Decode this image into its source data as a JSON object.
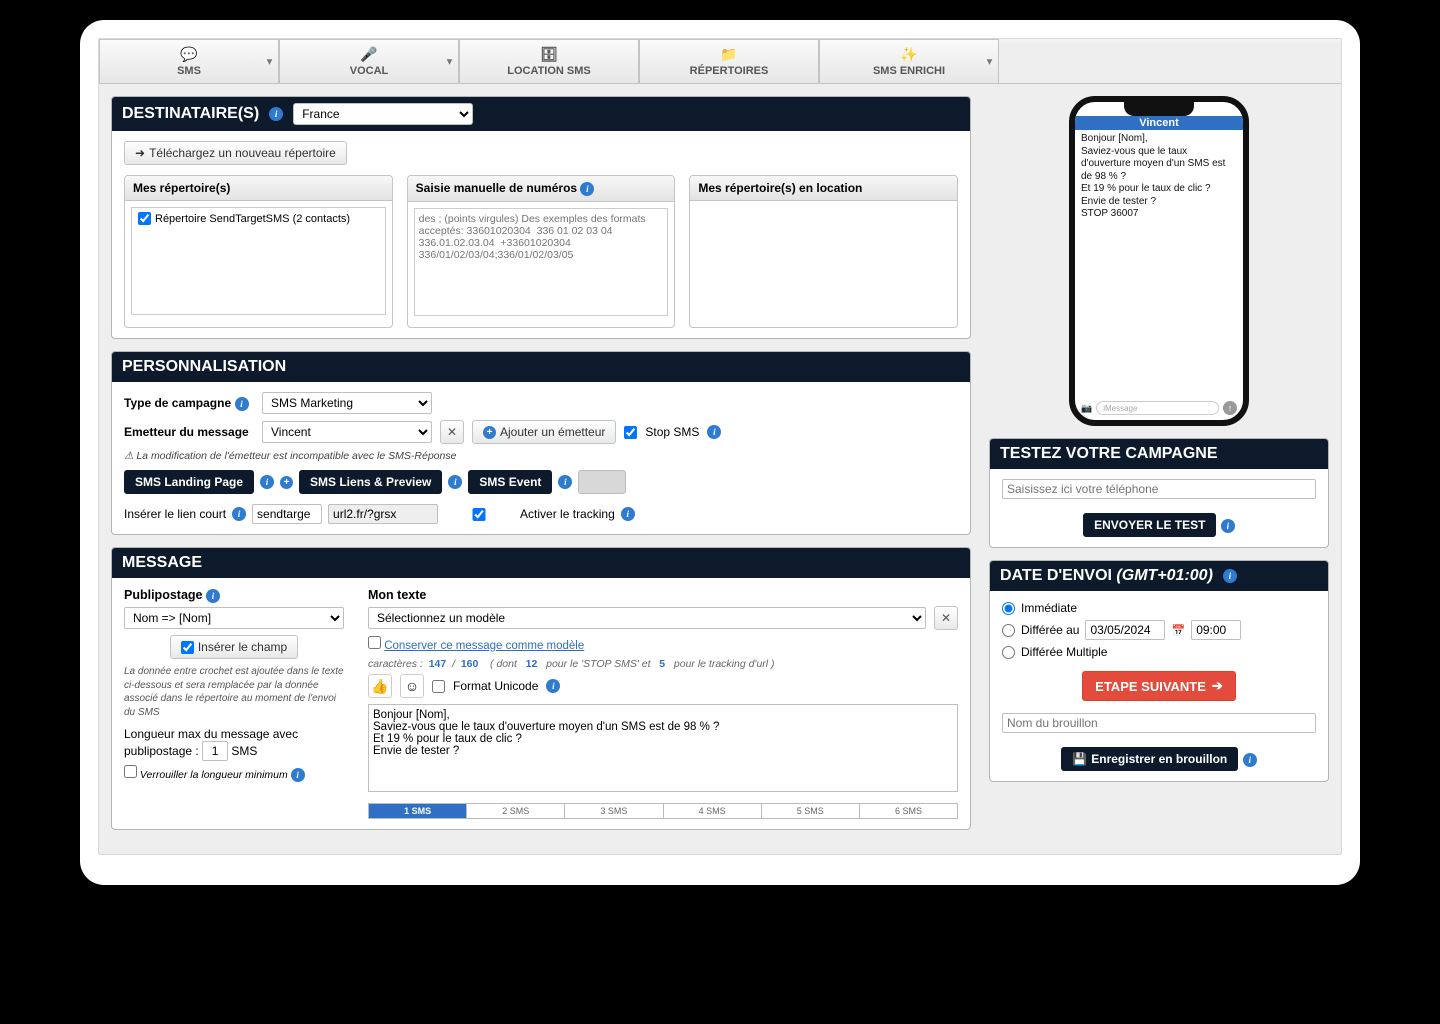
{
  "tabs": {
    "sms": "SMS",
    "vocal": "VOCAL",
    "location": "LOCATION SMS",
    "repertoires": "RÉPERTOIRES",
    "enrichi": "SMS ENRICHI"
  },
  "dest": {
    "title": "DESTINATAIRE(S)",
    "country": "France",
    "upload_btn": "Téléchargez un nouveau répertoire",
    "my_repos": "Mes répertoire(s)",
    "manual_entry": "Saisie manuelle de numéros",
    "rented_repos": "Mes répertoire(s) en location",
    "repo_item": "Répertoire SendTargetSMS (2 contacts)",
    "manual_placeholder": "des ; (points virgules) Des exemples des formats acceptés: 33601020304  336 01 02 03 04   336.01.02.03.04  +33601020304  336/01/02/03/04;336/01/02/03/05"
  },
  "perso": {
    "title": "PERSONNALISATION",
    "type_label": "Type de campagne",
    "type_value": "SMS Marketing",
    "emitter_label": "Emetteur du message",
    "emitter_value": "Vincent",
    "add_emitter": "Ajouter un émetteur",
    "stop_sms": "Stop SMS",
    "warning": "La modification de l'émetteur est incompatible avec le SMS-Réponse",
    "landing_btn": "SMS Landing Page",
    "liens_btn": "SMS Liens & Preview",
    "event_btn": "SMS Event",
    "insert_link_label": "Insérer le lien court",
    "shortcode_1": "sendtarge",
    "shortcode_2": "url2.fr/?grsx",
    "tracking": "Activer le tracking"
  },
  "msg": {
    "title": "MESSAGE",
    "publi_label": "Publipostage",
    "publi_select": "Nom   =>   [Nom]",
    "insert_field": "Insérer le champ",
    "publi_note": "La donnée entre crochet est ajoutée dans le texte ci-dessous et sera remplacée par la donnée associé dans le répertoire au moment de l'envoi du SMS",
    "maxlen_label": "Longueur max du message avec publipostage :",
    "maxlen_value": "1",
    "maxlen_unit": "SMS",
    "lock_label": "Verrouiller la longueur minimum",
    "texte_label": "Mon texte",
    "model_placeholder": "Sélectionnez un modèle",
    "save_model": "Conserver ce message comme modèle",
    "chars_prefix": "caractères :",
    "chars_cur": "147",
    "chars_sep": "/",
    "chars_max": "160",
    "chars_dont": "( dont",
    "chars_stop": "12",
    "chars_stop_label": "pour le 'STOP SMS' et",
    "chars_track": "5",
    "chars_track_label": "pour le tracking d'url )",
    "unicode": "Format Unicode",
    "body": "Bonjour [Nom],\nSaviez-vous que le taux d'ouverture moyen d'un SMS est de 98 % ?\nEt 19 % pour le taux de clic ?\nEnvie de tester ?",
    "meter": [
      "1 SMS",
      "2 SMS",
      "3 SMS",
      "4 SMS",
      "5 SMS",
      "6 SMS"
    ]
  },
  "phone": {
    "sender": "Vincent",
    "body": "Bonjour [Nom],\nSaviez-vous que le taux d'ouverture moyen d'un SMS est de 98 % ?\nEt 19 % pour le taux de clic ?\nEnvie de tester ?\nSTOP 36007",
    "input_ph": "iMessage"
  },
  "test": {
    "title": "TESTEZ VOTRE CAMPAGNE",
    "placeholder": "Saisissez ici votre téléphone",
    "send_btn": "ENVOYER LE TEST"
  },
  "sched": {
    "title_1": "DATE D'ENVOI",
    "title_2": "(GMT+01:00)",
    "immediate": "Immédiate",
    "deferred": "Différée au",
    "date": "03/05/2024",
    "time": "09:00",
    "multiple": "Différée Multiple",
    "next_btn": "ETAPE SUIVANTE",
    "draft_ph": "Nom du brouillon",
    "save_draft": "Enregistrer en brouillon"
  }
}
